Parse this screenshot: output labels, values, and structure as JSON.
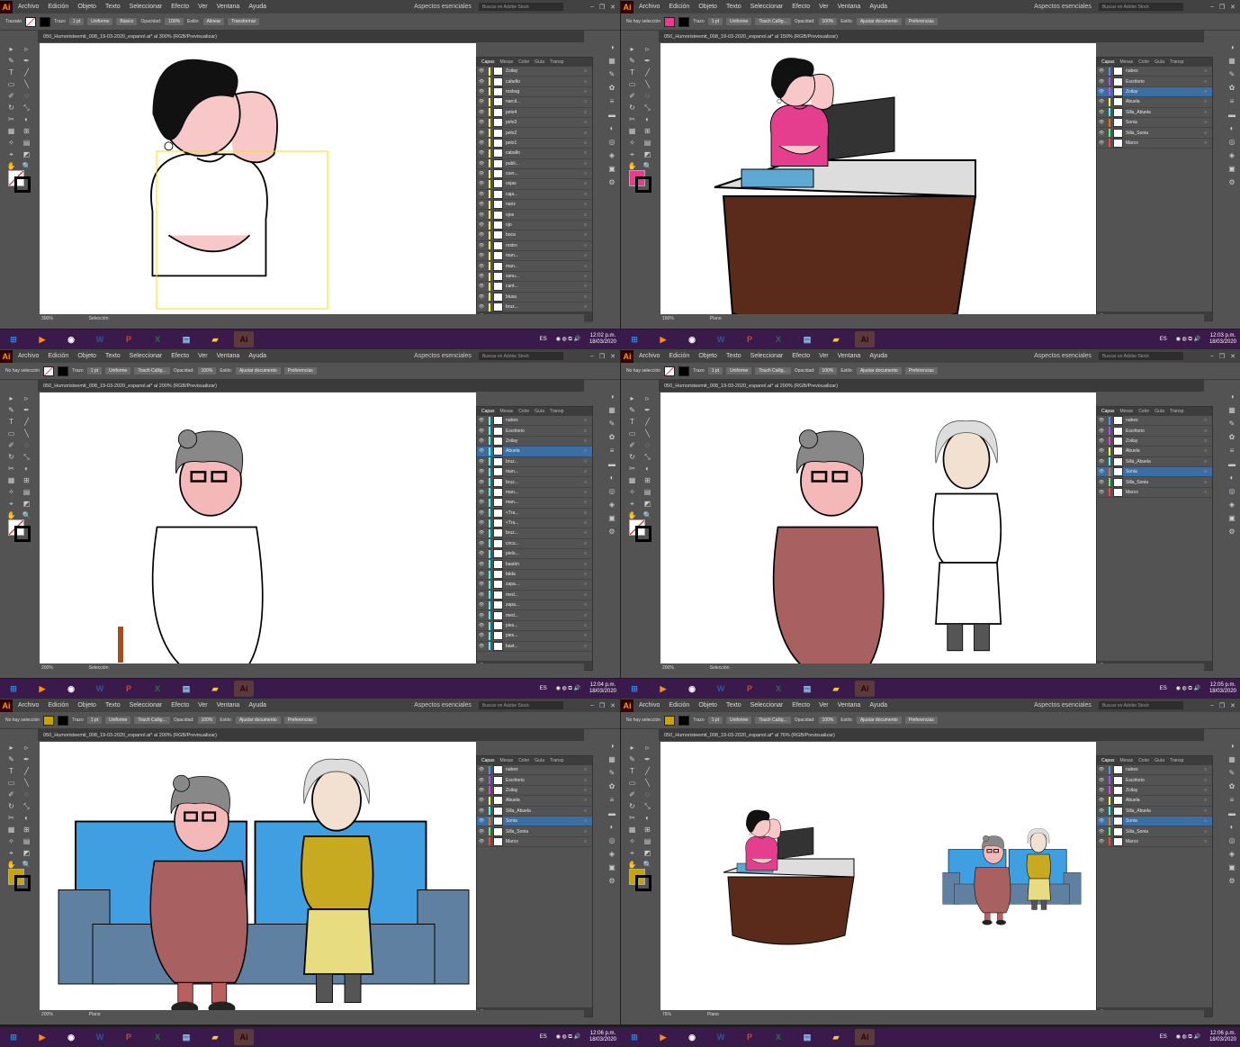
{
  "menu": [
    "Archivo",
    "Edición",
    "Objeto",
    "Texto",
    "Seleccionar",
    "Efecto",
    "Ver",
    "Ventana",
    "Ayuda"
  ],
  "workspace": "Aspectos esenciales",
  "search_placeholder": "Buscar en Adobe Stock",
  "ctrl": {
    "trazo": "Trazo",
    "weight": "1 pt",
    "uniforme": "Uniforme",
    "basico": "Básico",
    "caligrafia": "Touch Callig...",
    "opacidad": "Opacidad:",
    "opacity_val": "100%",
    "estilo": "Estilo:",
    "alinear": "Alinear",
    "transformar": "Transformar",
    "ajustar": "Ajustar documento",
    "preferencias": "Preferencias",
    "no_sel": "No hay selección",
    "trazado": "Trazado"
  },
  "panels": [
    {
      "title": "050_Humoristeemit_008_19-03-2020_espanol.ai* al 300% (RGB/Previsualizar)",
      "zoom": "300%",
      "status": "Selección",
      "time": "12:02 p.m.",
      "date": "18/03/2020",
      "layers_count": "8 capas",
      "layers": [
        "Zoilay",
        "cabello",
        "rosbug",
        "narcil...",
        "pelo4",
        "pelo3",
        "pelo2",
        "pelo1",
        "caballo",
        "publi...",
        "cuer...",
        "cejas",
        "caja...",
        "nariz",
        "ojos",
        "ojo",
        "boca",
        "rostro",
        "man...",
        "man...",
        "sanu...",
        "cant...",
        "blusa",
        "bruz...",
        "man..."
      ]
    },
    {
      "title": "050_Humoristeemit_008_19-03-2020_espanol.ai* al 150% (RGB/Previsualizar)",
      "zoom": "150%",
      "status": "Plano",
      "time": "12:03 p.m.",
      "date": "18/03/2020",
      "layers_count": "8 capas",
      "layers": [
        "nubes",
        "Escritorio",
        "Zoilay",
        "Abuela",
        "Silla_Abuela",
        "Sonia",
        "Silla_Sonia",
        "Marco"
      ]
    },
    {
      "title": "050_Humoristeemit_008_19-03-2020_espanol.ai* al 200% (RGB/Previsualizar)",
      "zoom": "200%",
      "status": "Selección",
      "time": "12:04 p.m.",
      "date": "18/03/2020",
      "layers_count": "8 capas",
      "layers": [
        "nubes",
        "Escritorio",
        "Zoilay",
        "Abuela",
        "bruz...",
        "man...",
        "bruz...",
        "man...",
        "man...",
        "<Tra...",
        "<Tra...",
        "bruz...",
        "circu...",
        "pielo...",
        "bastón",
        "falda",
        "zapa...",
        "med...",
        "zapa...",
        "med...",
        "pies...",
        "pies...",
        "bast..."
      ]
    },
    {
      "title": "050_Humoristeemit_008_19-03-2020_espanol.ai* al 200% (RGB/Previsualizar)",
      "zoom": "200%",
      "status": "Selección",
      "time": "12:05 p.m.",
      "date": "18/03/2020",
      "layers_count": "8 capas",
      "layers": [
        "nubes",
        "Escritorio",
        "Zoilay",
        "Abuela",
        "Silla_Abuela",
        "Sonia",
        "Silla_Sonia",
        "Marco"
      ]
    },
    {
      "title": "050_Humoristeemit_008_19-03-2020_espanol.ai* al 200% (RGB/Previsualizar)",
      "zoom": "200%",
      "status": "Plano",
      "time": "12:06 p.m.",
      "date": "18/03/2020",
      "layers_count": "8 capas",
      "layers": [
        "nubes",
        "Escritorio",
        "Zoilay",
        "Abuela",
        "Silla_Abuela",
        "Sonia",
        "Silla_Sonia",
        "Marco"
      ]
    },
    {
      "title": "050_Humoristeemit_008_19-03-2020_espanol.ai* al 76% (RGB/Previsualizar)",
      "zoom": "76%",
      "status": "Plano",
      "time": "12:06 p.m.",
      "date": "18/03/2020",
      "layers_count": "8 capas",
      "layers": [
        "nubes",
        "Escritorio",
        "Zoilay",
        "Abuela",
        "Silla_Abuela",
        "Sonia",
        "Silla_Sonia",
        "Marco"
      ]
    }
  ],
  "lang": "ES",
  "layers_tabs": [
    "Capas",
    "Mesas",
    "Color",
    "Guía",
    "Transp"
  ],
  "colors": {
    "accent": "#e63e8e",
    "sel": "#3a6ea5",
    "taskbar": "#3a1a4a"
  }
}
